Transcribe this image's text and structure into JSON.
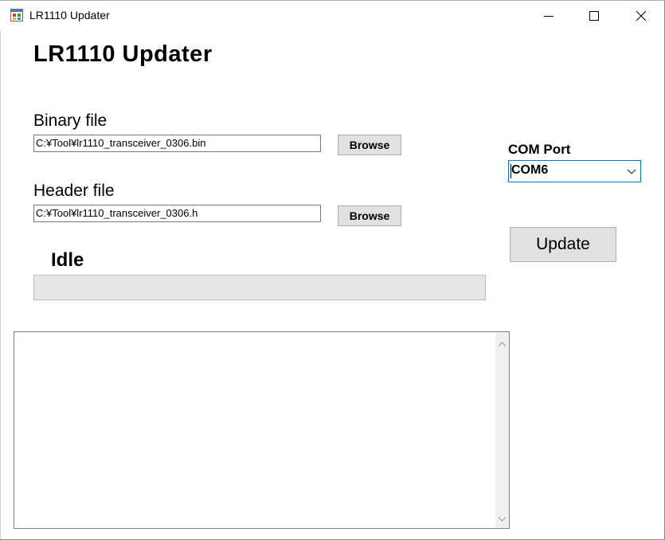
{
  "window": {
    "title": "LR1110 Updater",
    "icon": "app-window-icon",
    "controls": {
      "minimize_icon": "minimize-icon",
      "maximize_icon": "maximize-icon",
      "close_icon": "close-icon"
    }
  },
  "main": {
    "heading": "LR1110 Updater",
    "binary": {
      "label": "Binary file",
      "value": "C:¥Tool¥lr1110_transceiver_0306.bin",
      "browse_label": "Browse"
    },
    "header": {
      "label": "Header file",
      "value": "C:¥Tool¥lr1110_transceiver_0306.h",
      "browse_label": "Browse"
    },
    "status": "Idle",
    "progress": 0,
    "log": ""
  },
  "sidepanel": {
    "com_label": "COM Port",
    "com_value": "COM6",
    "update_label": "Update"
  },
  "colors": {
    "focus_border": "#0078d7",
    "button_face": "#e1e1e1",
    "progress_track": "#e6e6e6"
  }
}
